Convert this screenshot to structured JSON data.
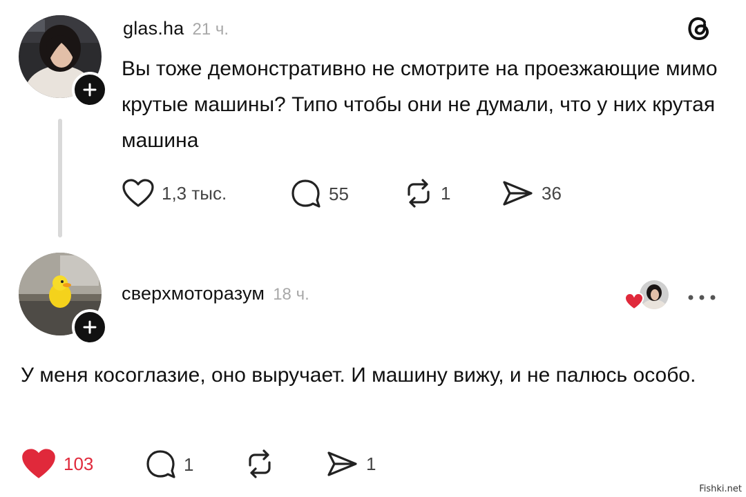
{
  "post": {
    "username": "glas.ha",
    "time": "21 ч.",
    "text": "Вы тоже демонстративно не смотрите на проезжающие мимо крутые машины? Типо чтобы они не думали, что у них крутая машина",
    "likes": "1,3 тыс.",
    "comments": "55",
    "reposts": "1",
    "shares": "36",
    "liked": false,
    "icons": [
      "threads-logo-icon",
      "plus-icon",
      "heart-icon",
      "comment-icon",
      "repost-icon",
      "share-icon"
    ]
  },
  "reply": {
    "username": "сверхмоторазум",
    "time": "18 ч.",
    "text": "У меня косоглазие, оно выручает. И машину вижу, и не палюсь особо.",
    "likes": "103",
    "comments": "1",
    "reposts": "",
    "shares": "1",
    "liked": true,
    "icons": [
      "heart-filled-icon",
      "comment-icon",
      "repost-icon",
      "share-icon",
      "more-icon"
    ]
  },
  "colors": {
    "like_red": "#e0293b",
    "muted": "#a8a8a8",
    "divider": "#d9d9d9"
  },
  "watermark": "Fishki.net"
}
